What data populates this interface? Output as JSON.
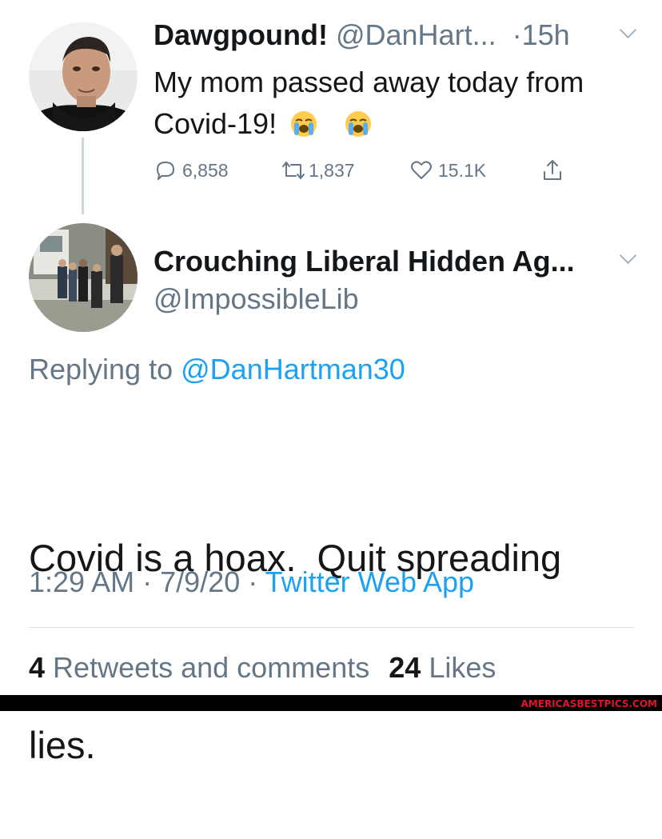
{
  "original_tweet": {
    "display_name": "Dawgpound!",
    "handle": "@DanHart...",
    "time": "·15h",
    "text_line1": "My mom passed away today from",
    "text_line2": "Covid-19!",
    "emojis": [
      "loudly-crying-face",
      "loudly-crying-face"
    ],
    "replies": "6,858",
    "retweets": "1,837",
    "likes": "15.1K"
  },
  "reply_tweet": {
    "display_name": "Crouching Liberal Hidden Ag...",
    "handle": "@ImpossibleLib",
    "replying_prefix": "Replying to",
    "replying_to": "@DanHartman30",
    "text_line1": "Covid is a hoax.  Quit spreading",
    "text_line2": "lies.",
    "time": "1:29 AM",
    "date": "7/9/20",
    "source": "Twitter Web App",
    "retweets_count": "4",
    "retweets_label": "Retweets and comments",
    "likes_count": "24",
    "likes_label": "Likes"
  },
  "watermark": "AMERICASBESTPICS.COM",
  "colors": {
    "link": "#1da1f2",
    "secondary": "#657786",
    "text": "#14171a"
  }
}
